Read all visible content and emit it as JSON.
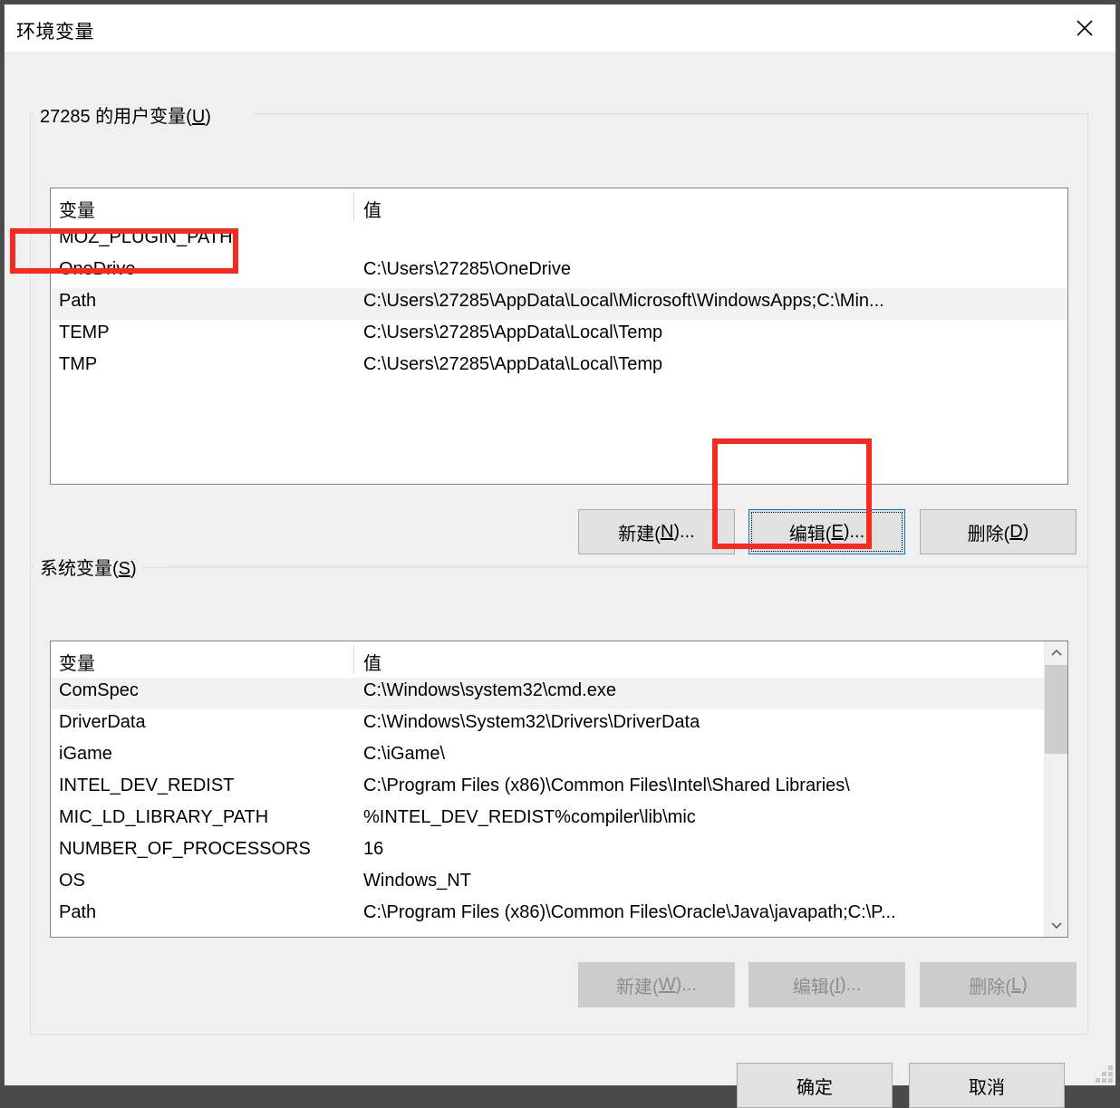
{
  "window": {
    "title": "环境变量",
    "close_icon": "close-icon"
  },
  "user_section": {
    "legend_prefix": "27285 的用户变量(",
    "legend_accel": "U",
    "legend_suffix": ")",
    "columns": {
      "name": "变量",
      "value": "值"
    },
    "rows": [
      {
        "name": "MOZ_PLUGIN_PATH",
        "value": ""
      },
      {
        "name": "OneDrive",
        "value": "C:\\Users\\27285\\OneDrive"
      },
      {
        "name": "Path",
        "value": "C:\\Users\\27285\\AppData\\Local\\Microsoft\\WindowsApps;C:\\Min..."
      },
      {
        "name": "TEMP",
        "value": "C:\\Users\\27285\\AppData\\Local\\Temp"
      },
      {
        "name": "TMP",
        "value": "C:\\Users\\27285\\AppData\\Local\\Temp"
      }
    ],
    "selected_index": 2,
    "buttons": {
      "new": {
        "prefix": "新建(",
        "accel": "N",
        "suffix": ")..."
      },
      "edit": {
        "prefix": "编辑(",
        "accel": "E",
        "suffix": ")..."
      },
      "delete": {
        "prefix": "删除(",
        "accel": "D",
        "suffix": ")"
      }
    }
  },
  "system_section": {
    "legend_prefix": "系统变量(",
    "legend_accel": "S",
    "legend_suffix": ")",
    "columns": {
      "name": "变量",
      "value": "值"
    },
    "rows": [
      {
        "name": "ComSpec",
        "value": "C:\\Windows\\system32\\cmd.exe"
      },
      {
        "name": "DriverData",
        "value": "C:\\Windows\\System32\\Drivers\\DriverData"
      },
      {
        "name": "iGame",
        "value": "C:\\iGame\\"
      },
      {
        "name": "INTEL_DEV_REDIST",
        "value": "C:\\Program Files (x86)\\Common Files\\Intel\\Shared Libraries\\"
      },
      {
        "name": "MIC_LD_LIBRARY_PATH",
        "value": "%INTEL_DEV_REDIST%compiler\\lib\\mic"
      },
      {
        "name": "NUMBER_OF_PROCESSORS",
        "value": "16"
      },
      {
        "name": "OS",
        "value": "Windows_NT"
      },
      {
        "name": "Path",
        "value": "C:\\Program Files (x86)\\Common Files\\Oracle\\Java\\javapath;C:\\P..."
      }
    ],
    "selected_index": 0,
    "scrollbar": {
      "up_icon": "chevron-up-icon",
      "down_icon": "chevron-down-icon"
    },
    "buttons": {
      "new": {
        "prefix": "新建(",
        "accel": "W",
        "suffix": ")..."
      },
      "edit": {
        "prefix": "编辑(",
        "accel": "I",
        "suffix": ")..."
      },
      "delete": {
        "prefix": "删除(",
        "accel": "L",
        "suffix": ")"
      }
    }
  },
  "footer": {
    "ok": "确定",
    "cancel": "取消"
  },
  "annotations": {
    "highlight_color": "#f52b21",
    "items": [
      {
        "target": "user-list-row-path-name"
      },
      {
        "target": "user-edit-button"
      }
    ]
  }
}
